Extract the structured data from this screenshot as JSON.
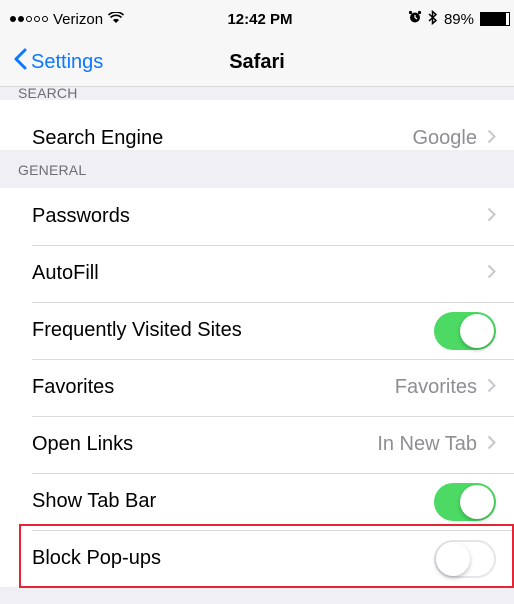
{
  "status_bar": {
    "signal_dots_filled": 2,
    "signal_dots_total": 5,
    "carrier": "Verizon",
    "wifi_icon": "wifi-icon",
    "time": "12:42 PM",
    "alarm_icon": "alarm-icon",
    "bluetooth_icon": "bluetooth-icon",
    "battery_percent": "89%",
    "battery_level": 0.89
  },
  "nav": {
    "back_label": "Settings",
    "title": "Safari"
  },
  "sections": {
    "search": {
      "header": "SEARCH",
      "rows": {
        "search_engine": {
          "label": "Search Engine",
          "detail": "Google"
        }
      }
    },
    "general": {
      "header": "GENERAL",
      "rows": {
        "passwords": {
          "label": "Passwords"
        },
        "autofill": {
          "label": "AutoFill"
        },
        "frequently_visited": {
          "label": "Frequently Visited Sites",
          "toggle": "on"
        },
        "favorites": {
          "label": "Favorites",
          "detail": "Favorites"
        },
        "open_links": {
          "label": "Open Links",
          "detail": "In New Tab"
        },
        "show_tab_bar": {
          "label": "Show Tab Bar",
          "toggle": "on"
        },
        "block_popups": {
          "label": "Block Pop-ups",
          "toggle": "off"
        }
      }
    }
  },
  "colors": {
    "accent": "#0a78ff",
    "toggle_on": "#4cd964",
    "highlight": "#e52535"
  }
}
